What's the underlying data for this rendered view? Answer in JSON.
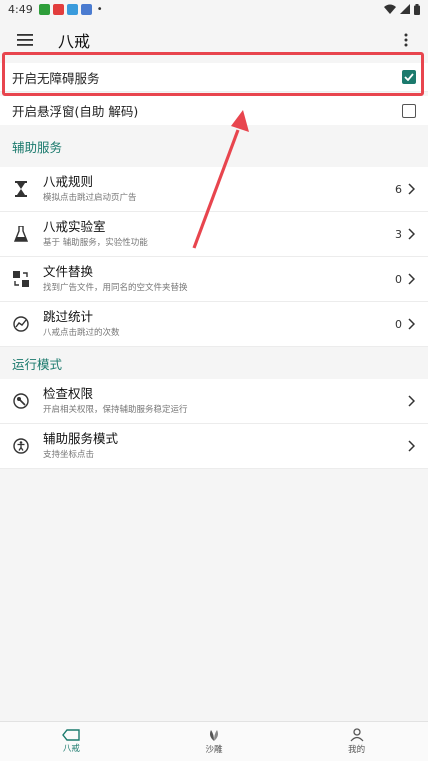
{
  "status_bar": {
    "time": "4:49",
    "dot": "•"
  },
  "app_bar": {
    "title": "八戒"
  },
  "switches": [
    {
      "label": "开启无障碍服务",
      "checked": true
    },
    {
      "label": "开启悬浮窗(自助 解码)",
      "checked": false
    }
  ],
  "section1": {
    "header": "辅助服务",
    "items": [
      {
        "title": "八戒规则",
        "subtitle": "模拟点击跳过启动页广告",
        "count": "6",
        "icon": "hourglass-icon"
      },
      {
        "title": "八戒实验室",
        "subtitle": "基于 辅助服务，实验性功能",
        "count": "3",
        "icon": "flask-icon"
      },
      {
        "title": "文件替换",
        "subtitle": "找到广告文件，用同名的空文件夹替换",
        "count": "0",
        "icon": "file-replace-icon"
      },
      {
        "title": "跳过统计",
        "subtitle": "八戒点击跳过的次数",
        "count": "0",
        "icon": "stats-icon"
      }
    ]
  },
  "section2": {
    "header": "运行模式",
    "items": [
      {
        "title": "检查权限",
        "subtitle": "开启相关权限，保持辅助服务稳定运行",
        "icon": "permission-icon"
      },
      {
        "title": "辅助服务模式",
        "subtitle": "支持坐标点击",
        "icon": "accessibility-icon"
      }
    ]
  },
  "bottom_nav": [
    {
      "label": "八戒",
      "active": true
    },
    {
      "label": "沙雕",
      "active": false
    },
    {
      "label": "我的",
      "active": false
    }
  ],
  "colors": {
    "accent": "#1b7a6d",
    "highlight": "#e8454e"
  }
}
